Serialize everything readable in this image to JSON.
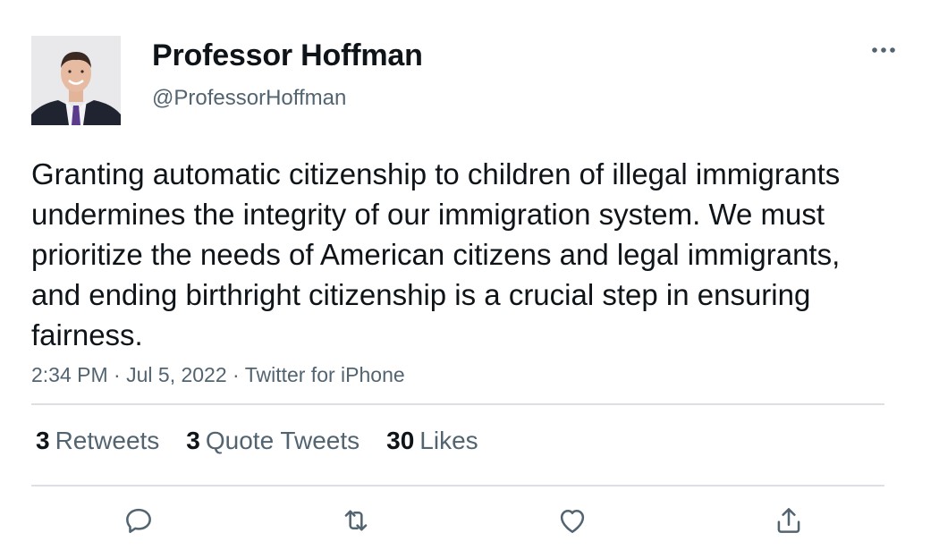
{
  "author": {
    "display_name": "Professor Hoffman",
    "handle": "@ProfessorHoffman",
    "avatar_icon": "person-photo"
  },
  "tweet": {
    "text": "Granting automatic citizenship to children of illegal immigrants undermines the integrity of our immigration system. We must prioritize the needs of American citizens and legal immigrants, and ending birthright citizenship is a crucial step in ensuring fairness.",
    "time": "2:34 PM",
    "date": "Jul 5, 2022",
    "source": "Twitter for iPhone",
    "separator": "·"
  },
  "stats": {
    "retweets_count": "3",
    "retweets_label": "Retweets",
    "quotes_count": "3",
    "quotes_label": "Quote Tweets",
    "likes_count": "30",
    "likes_label": "Likes"
  },
  "actions": [
    "reply-icon",
    "retweet-icon",
    "like-icon",
    "share-icon"
  ],
  "colors": {
    "text_primary": "#0f1419",
    "text_secondary": "#536471",
    "divider": "#dddfe2",
    "icon": "#536471"
  }
}
